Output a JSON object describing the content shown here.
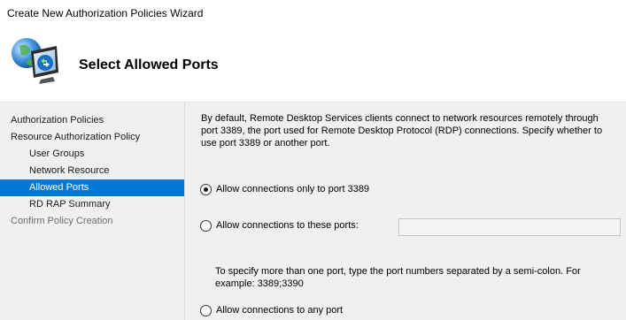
{
  "window": {
    "title": "Create New Authorization Policies Wizard"
  },
  "header": {
    "page_title": "Select Allowed Ports",
    "icon": "remote-desktop-icon"
  },
  "nav": {
    "items": [
      {
        "label": "Authorization Policies",
        "level": 0,
        "state": "normal"
      },
      {
        "label": "Resource Authorization Policy",
        "level": 0,
        "state": "normal"
      },
      {
        "label": "User Groups",
        "level": 1,
        "state": "normal"
      },
      {
        "label": "Network Resource",
        "level": 1,
        "state": "normal"
      },
      {
        "label": "Allowed Ports",
        "level": 1,
        "state": "active"
      },
      {
        "label": "RD RAP Summary",
        "level": 1,
        "state": "normal"
      },
      {
        "label": "Confirm Policy Creation",
        "level": 0,
        "state": "disabled"
      }
    ]
  },
  "main": {
    "description": "By default, Remote Desktop Services clients connect to network resources remotely through port 3389, the port used for Remote Desktop Protocol (RDP) connections. Specify whether to use port 3389 or another port.",
    "options": [
      {
        "label": "Allow connections only to port 3389",
        "selected": true
      },
      {
        "label": "Allow connections to these ports:",
        "selected": false
      },
      {
        "label": "Allow connections to any port",
        "selected": false
      }
    ],
    "ports_input": {
      "value": "",
      "enabled": false
    },
    "hint": "To specify more than one port, type the port numbers separated by a semi-colon. For example: 3389;3390"
  },
  "colors": {
    "selection": "#0078d7",
    "panel": "#f0f0f0"
  }
}
